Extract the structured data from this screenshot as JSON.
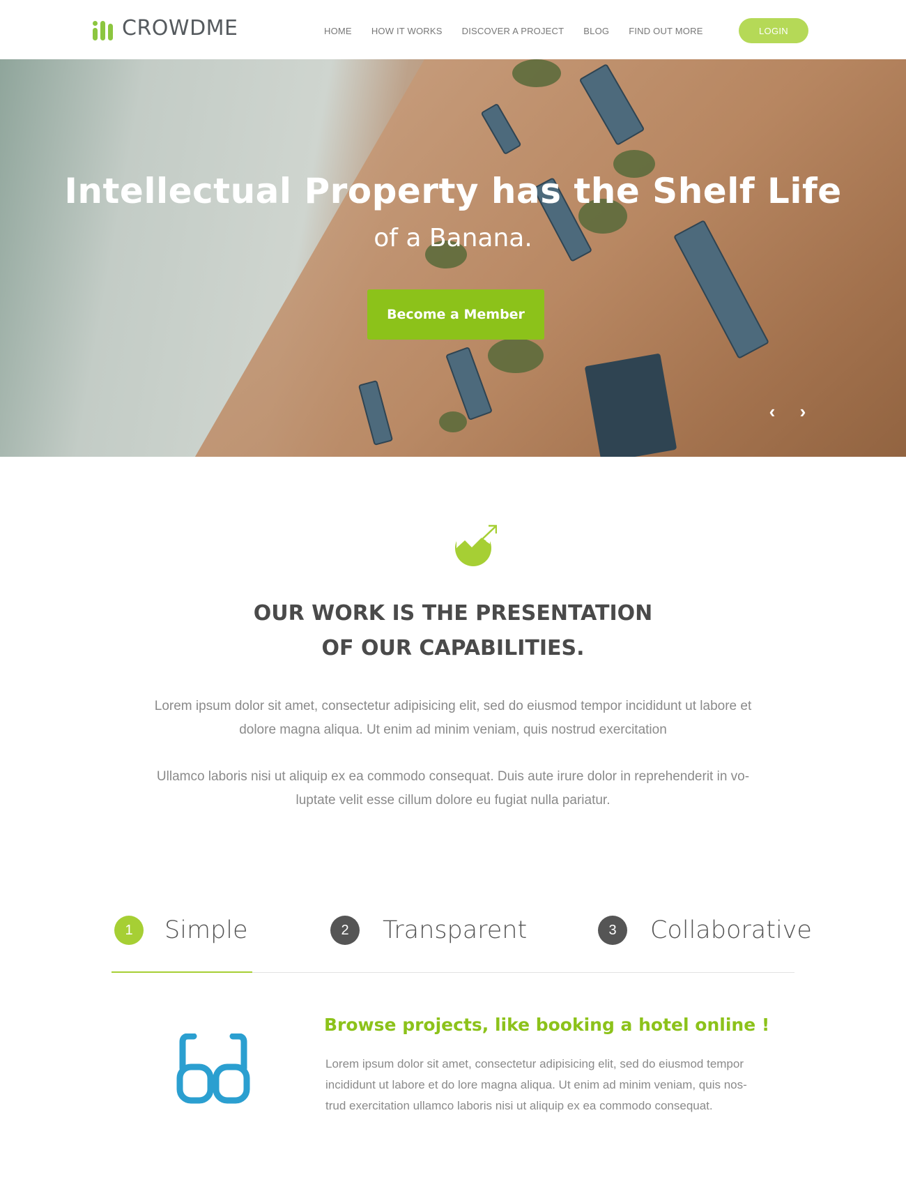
{
  "brand": {
    "name": "CROWDME",
    "accent": "#8cc21a"
  },
  "nav": {
    "items": [
      {
        "label": "HOME"
      },
      {
        "label": "HOW IT WORKS"
      },
      {
        "label": "DISCOVER A PROJECT"
      },
      {
        "label": "BLOG"
      },
      {
        "label": "FIND OUT MORE"
      }
    ],
    "login_label": "LOGIN"
  },
  "hero": {
    "title": "Intellectual Property has the Shelf Life",
    "subtitle": "of a Banana.",
    "cta_label": "Become a Member",
    "prev_icon": "chevron-left-icon",
    "next_icon": "chevron-right-icon"
  },
  "intro": {
    "icon": "growth-chart-icon",
    "title_line1": "OUR WORK IS THE PRESENTATION",
    "title_line2": "OF OUR CAPABILITIES.",
    "p1_line1": "Lorem ipsum dolor sit amet, consectetur adipisicing elit, sed do eiusmod tempor incididunt ut labore et",
    "p1_line2": "dolore magna aliqua. Ut enim ad minim veniam, quis nostrud exercitation",
    "p2_line1": "Ullamco laboris nisi ut aliquip ex ea commodo consequat. Duis aute irure dolor in reprehenderit in vo-",
    "p2_line2": "luptate velit esse cillum dolore eu fugiat nulla pariatur."
  },
  "steps": [
    {
      "number": "1",
      "label": "Simple",
      "active": true
    },
    {
      "number": "2",
      "label": "Transparent",
      "active": false
    },
    {
      "number": "3",
      "label": "Collaborative",
      "active": false
    }
  ],
  "feature": {
    "icon": "glasses-icon",
    "title": "Browse projects, like booking a hotel online !",
    "line1": "Lorem ipsum dolor sit amet, consectetur adipisicing elit, sed do eiusmod tempor",
    "line2": "incididunt ut labore et do lore magna aliqua. Ut enim ad minim veniam, quis nos-",
    "line3": "trud exercitation ullamco laboris nisi ut aliquip ex ea commodo consequat."
  }
}
